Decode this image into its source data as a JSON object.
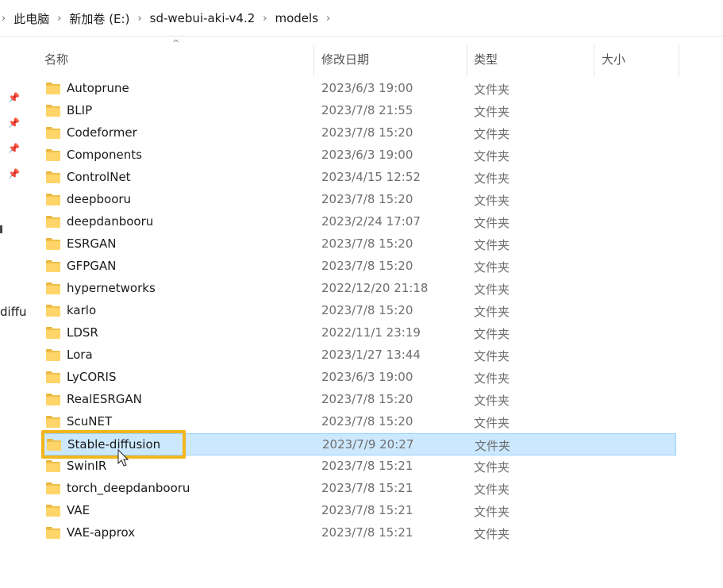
{
  "breadcrumb": [
    "此电脑",
    "新加卷 (E:)",
    "sd-webui-aki-v4.2",
    "models"
  ],
  "nav": {
    "partial_label": "diffu"
  },
  "columns": {
    "name": "名称",
    "date": "修改日期",
    "type": "类型",
    "size": "大小"
  },
  "selected_index": 16,
  "colors": {
    "selection_bg": "#cce8ff",
    "selection_border": "#99d1ff",
    "highlight_box": "#f2b61c",
    "folder": "#ffd56a"
  },
  "rows": [
    {
      "name": "Autoprune",
      "date": "2023/6/3 19:00",
      "type": "文件夹"
    },
    {
      "name": "BLIP",
      "date": "2023/7/8 21:55",
      "type": "文件夹"
    },
    {
      "name": "Codeformer",
      "date": "2023/7/8 15:20",
      "type": "文件夹"
    },
    {
      "name": "Components",
      "date": "2023/6/3 19:00",
      "type": "文件夹"
    },
    {
      "name": "ControlNet",
      "date": "2023/4/15 12:52",
      "type": "文件夹"
    },
    {
      "name": "deepbooru",
      "date": "2023/7/8 15:20",
      "type": "文件夹"
    },
    {
      "name": "deepdanbooru",
      "date": "2023/2/24 17:07",
      "type": "文件夹"
    },
    {
      "name": "ESRGAN",
      "date": "2023/7/8 15:20",
      "type": "文件夹"
    },
    {
      "name": "GFPGAN",
      "date": "2023/7/8 15:20",
      "type": "文件夹"
    },
    {
      "name": "hypernetworks",
      "date": "2022/12/20 21:18",
      "type": "文件夹"
    },
    {
      "name": "karlo",
      "date": "2023/7/8 15:20",
      "type": "文件夹"
    },
    {
      "name": "LDSR",
      "date": "2022/11/1 23:19",
      "type": "文件夹"
    },
    {
      "name": "Lora",
      "date": "2023/1/27 13:44",
      "type": "文件夹"
    },
    {
      "name": "LyCORIS",
      "date": "2023/6/3 19:00",
      "type": "文件夹"
    },
    {
      "name": "RealESRGAN",
      "date": "2023/7/8 15:20",
      "type": "文件夹"
    },
    {
      "name": "ScuNET",
      "date": "2023/7/8 15:20",
      "type": "文件夹"
    },
    {
      "name": "Stable-diffusion",
      "date": "2023/7/9 20:27",
      "type": "文件夹"
    },
    {
      "name": "SwinIR",
      "date": "2023/7/8 15:21",
      "type": "文件夹"
    },
    {
      "name": "torch_deepdanbooru",
      "date": "2023/7/8 15:21",
      "type": "文件夹"
    },
    {
      "name": "VAE",
      "date": "2023/7/8 15:21",
      "type": "文件夹"
    },
    {
      "name": "VAE-approx",
      "date": "2023/7/8 15:21",
      "type": "文件夹"
    }
  ]
}
